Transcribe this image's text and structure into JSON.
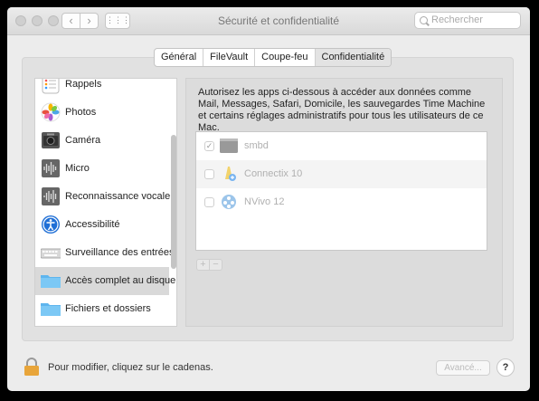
{
  "window": {
    "title": "Sécurité et confidentialité"
  },
  "toolbar": {
    "back": "‹",
    "forward": "›",
    "grid": "⋮⋮⋮",
    "search_placeholder": "Rechercher"
  },
  "tabs": [
    {
      "label": "Général",
      "active": false
    },
    {
      "label": "FileVault",
      "active": false
    },
    {
      "label": "Coupe-feu",
      "active": false
    },
    {
      "label": "Confidentialité",
      "active": true
    }
  ],
  "sidebar": {
    "items": [
      {
        "label": "Rappels",
        "icon": "reminders-icon"
      },
      {
        "label": "Photos",
        "icon": "photos-icon"
      },
      {
        "label": "Caméra",
        "icon": "camera-icon"
      },
      {
        "label": "Micro",
        "icon": "microphone-icon"
      },
      {
        "label": "Reconnaissance vocale",
        "icon": "speech-recognition-icon"
      },
      {
        "label": "Accessibilité",
        "icon": "accessibility-icon"
      },
      {
        "label": "Surveillance des entrées",
        "icon": "keyboard-icon"
      },
      {
        "label": "Accès complet au disque",
        "icon": "folder-icon",
        "selected": true
      },
      {
        "label": "Fichiers et dossiers",
        "icon": "folder-icon"
      }
    ]
  },
  "main": {
    "description": "Autorisez les apps ci-dessous à accéder aux données comme Mail, Messages, Safari, Domicile, les sauvegardes Time Machine et certains réglages administratifs pour tous les utilisateurs de ce Mac.",
    "apps": [
      {
        "name": "smbd",
        "checked": true,
        "icon": "terminal-icon"
      },
      {
        "name": "Connectix 10",
        "checked": false,
        "icon": "connectix-icon"
      },
      {
        "name": "NVivo 12",
        "checked": false,
        "icon": "nvivo-icon"
      }
    ],
    "plus": "+",
    "minus": "−",
    "checkmark": "✓"
  },
  "footer": {
    "lock_text": "Pour modifier, cliquez sur le cadenas.",
    "advanced": "Avancé...",
    "help": "?"
  },
  "colors": {
    "selected_row": "#d9d9d9",
    "lock": "#e8a53a"
  }
}
